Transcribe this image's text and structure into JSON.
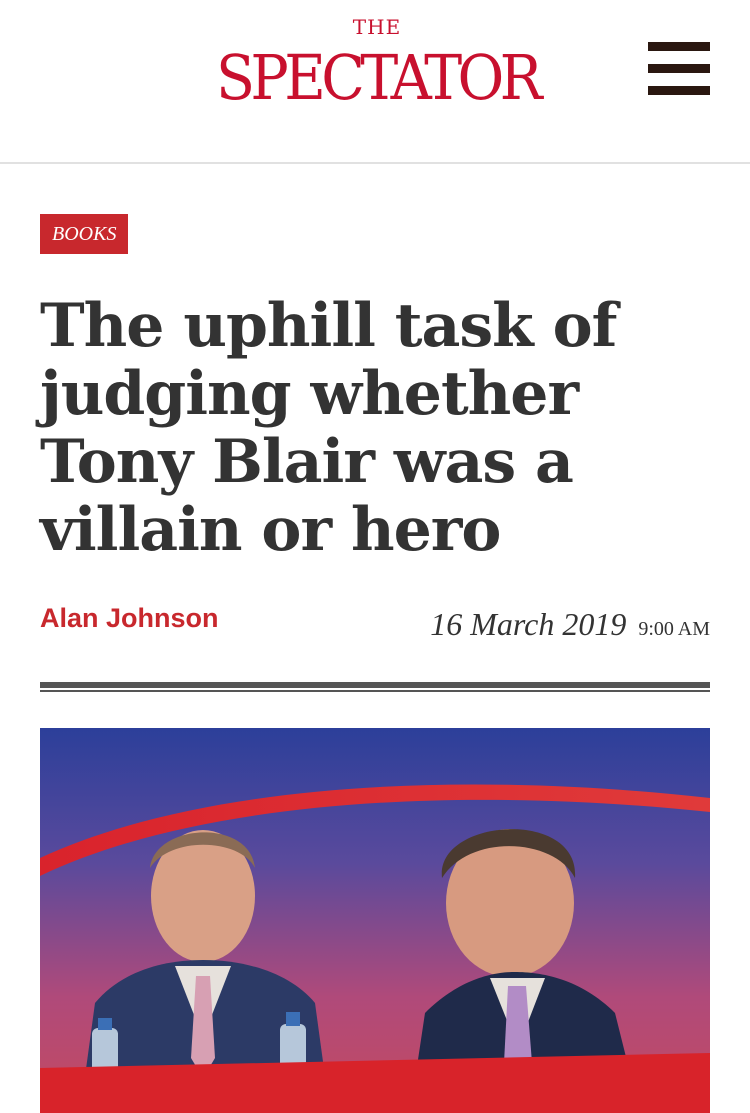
{
  "header": {
    "logo_the": "THE",
    "logo_main": "SPECTATOR",
    "menu_icon": "hamburger-menu-icon"
  },
  "article": {
    "section_tag": "BOOKS",
    "headline": "The uphill task of judging whether Tony Blair was a villain or hero",
    "author": "Alan Johnson",
    "date": "16 March 2019",
    "time": "9:00 AM"
  },
  "colors": {
    "brand_red": "#c8102e",
    "tag_red": "#c8282d",
    "text_dark": "#333333"
  }
}
